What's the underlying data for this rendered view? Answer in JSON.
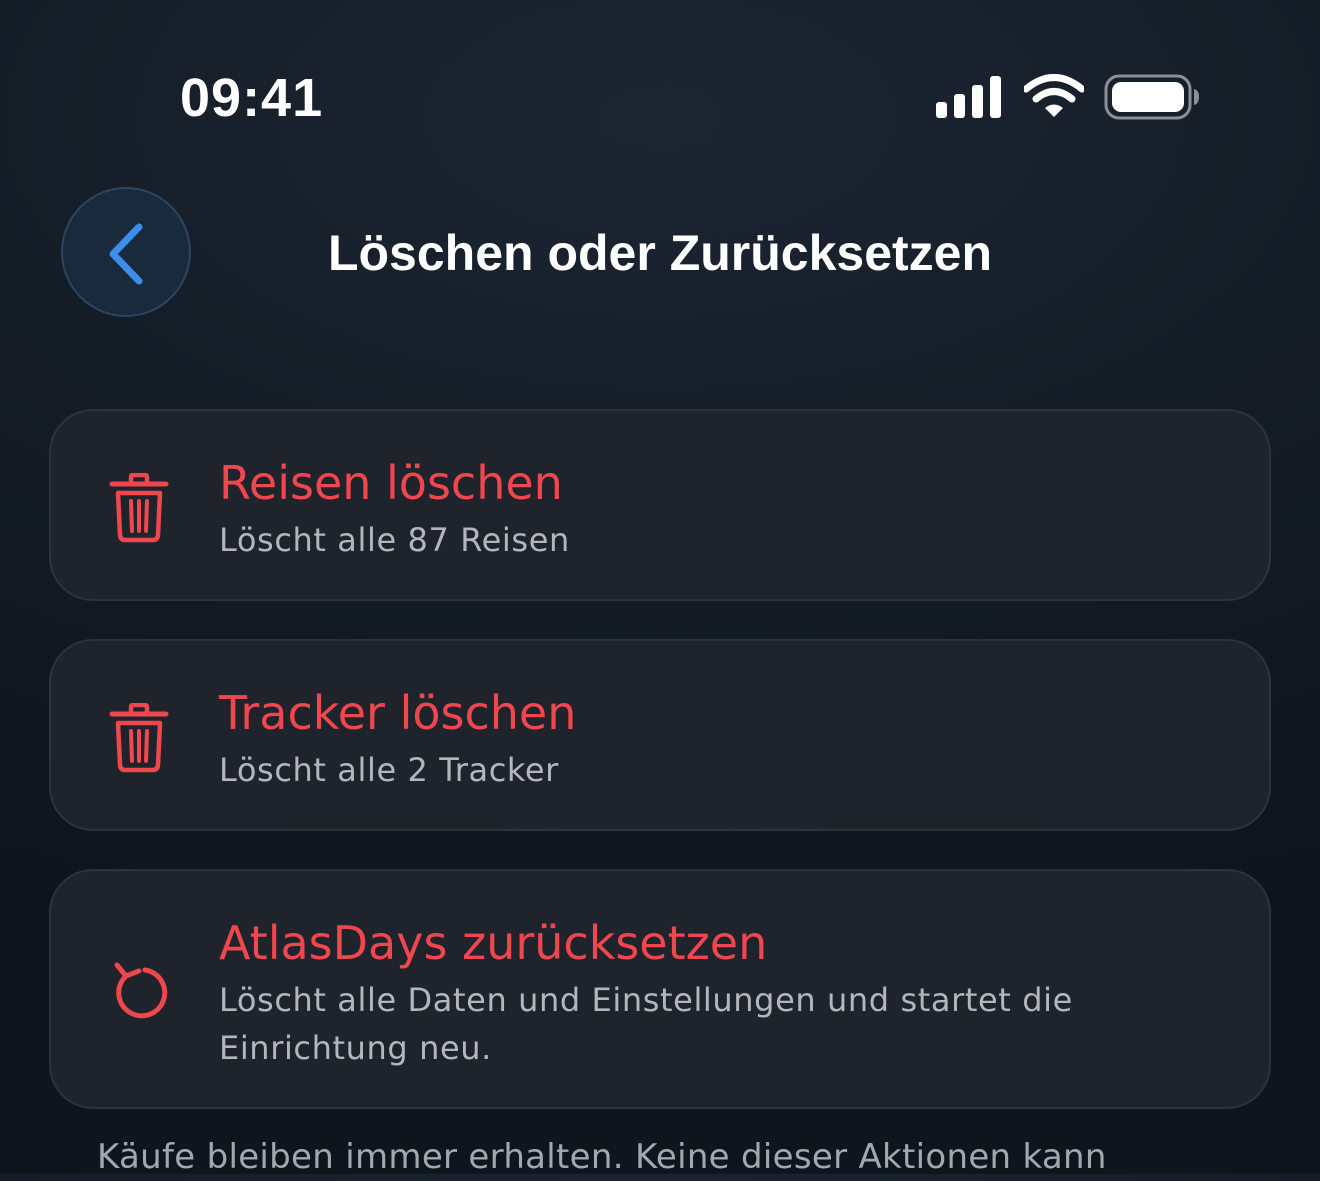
{
  "status_bar": {
    "time": "09:41",
    "icons": [
      "signal-icon",
      "wifi-icon",
      "battery-icon"
    ]
  },
  "header": {
    "back_icon": "chevron-left-icon",
    "title": "Löschen oder Zurücksetzen"
  },
  "actions": [
    {
      "icon": "trash-icon",
      "title": "Reisen löschen",
      "subtitle": "Löscht alle 87 Reisen"
    },
    {
      "icon": "trash-icon",
      "title": "Tracker löschen",
      "subtitle": "Löscht alle 2 Tracker"
    },
    {
      "icon": "reset-icon",
      "title": "AtlasDays zurücksetzen",
      "subtitle": "Löscht alle Daten und Einstellungen und startet die Einrichtung neu."
    }
  ],
  "footer": {
    "note": "Käufe bleiben immer erhalten. Keine dieser Aktionen kann"
  },
  "colors": {
    "destructive": "#f0464e",
    "accent": "#3d8ee8",
    "card_background": "#1f242c",
    "background": "#141c26"
  }
}
